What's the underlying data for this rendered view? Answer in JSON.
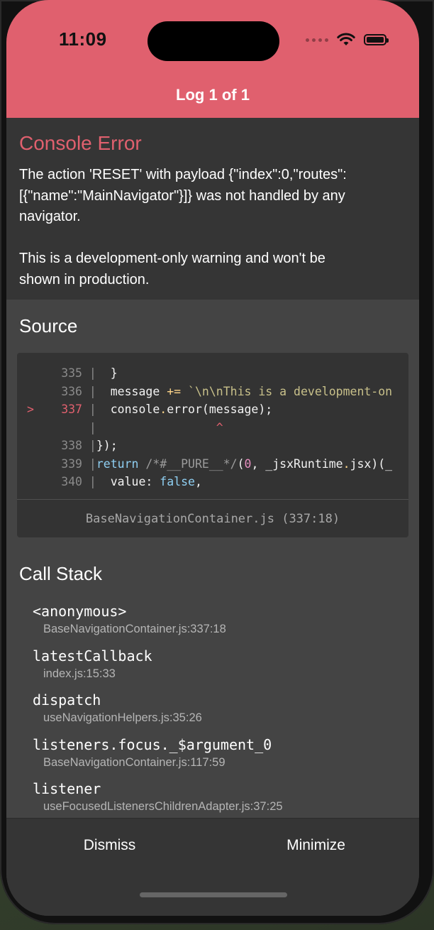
{
  "status_bar": {
    "time": "11:09"
  },
  "header": {
    "title": "Log 1 of 1"
  },
  "error": {
    "title": "Console Error",
    "message": "The action 'RESET' with payload {\"index\":0,\"routes\":\n[{\"name\":\"MainNavigator\"}]} was not handled by any\nnavigator.\n\nThis is a development-only warning and won't be\nshown in production."
  },
  "source": {
    "heading": "Source",
    "lines": [
      {
        "num": "335",
        "marker": "",
        "code": "  }"
      },
      {
        "num": "336",
        "marker": "",
        "code": "  message += `\\n\\nThis is a development-on"
      },
      {
        "num": "337",
        "marker": ">",
        "code": "  console.error(message);"
      },
      {
        "num": "",
        "marker": "",
        "code": "                 ^"
      },
      {
        "num": "338",
        "marker": "",
        "code": "});"
      },
      {
        "num": "339",
        "marker": "",
        "code": "return /*#__PURE__*/(0, _jsxRuntime.jsx)(_"
      },
      {
        "num": "340",
        "marker": "",
        "code": "  value: false,"
      }
    ],
    "file_location": "BaseNavigationContainer.js (337:18)"
  },
  "call_stack": {
    "heading": "Call Stack",
    "frames": [
      {
        "fn": "<anonymous>",
        "loc": "BaseNavigationContainer.js:337:18"
      },
      {
        "fn": "latestCallback",
        "loc": "index.js:15:33"
      },
      {
        "fn": "dispatch",
        "loc": "useNavigationHelpers.js:35:26"
      },
      {
        "fn": "listeners.focus._$argument_0",
        "loc": "BaseNavigationContainer.js:117:59"
      },
      {
        "fn": "listener",
        "loc": "useFocusedListenersChildrenAdapter.js:37:25"
      }
    ]
  },
  "footer": {
    "dismiss_label": "Dismiss",
    "minimize_label": "Minimize"
  },
  "colors": {
    "accent": "#e0606e",
    "panel": "#353535",
    "body": "#444444"
  }
}
